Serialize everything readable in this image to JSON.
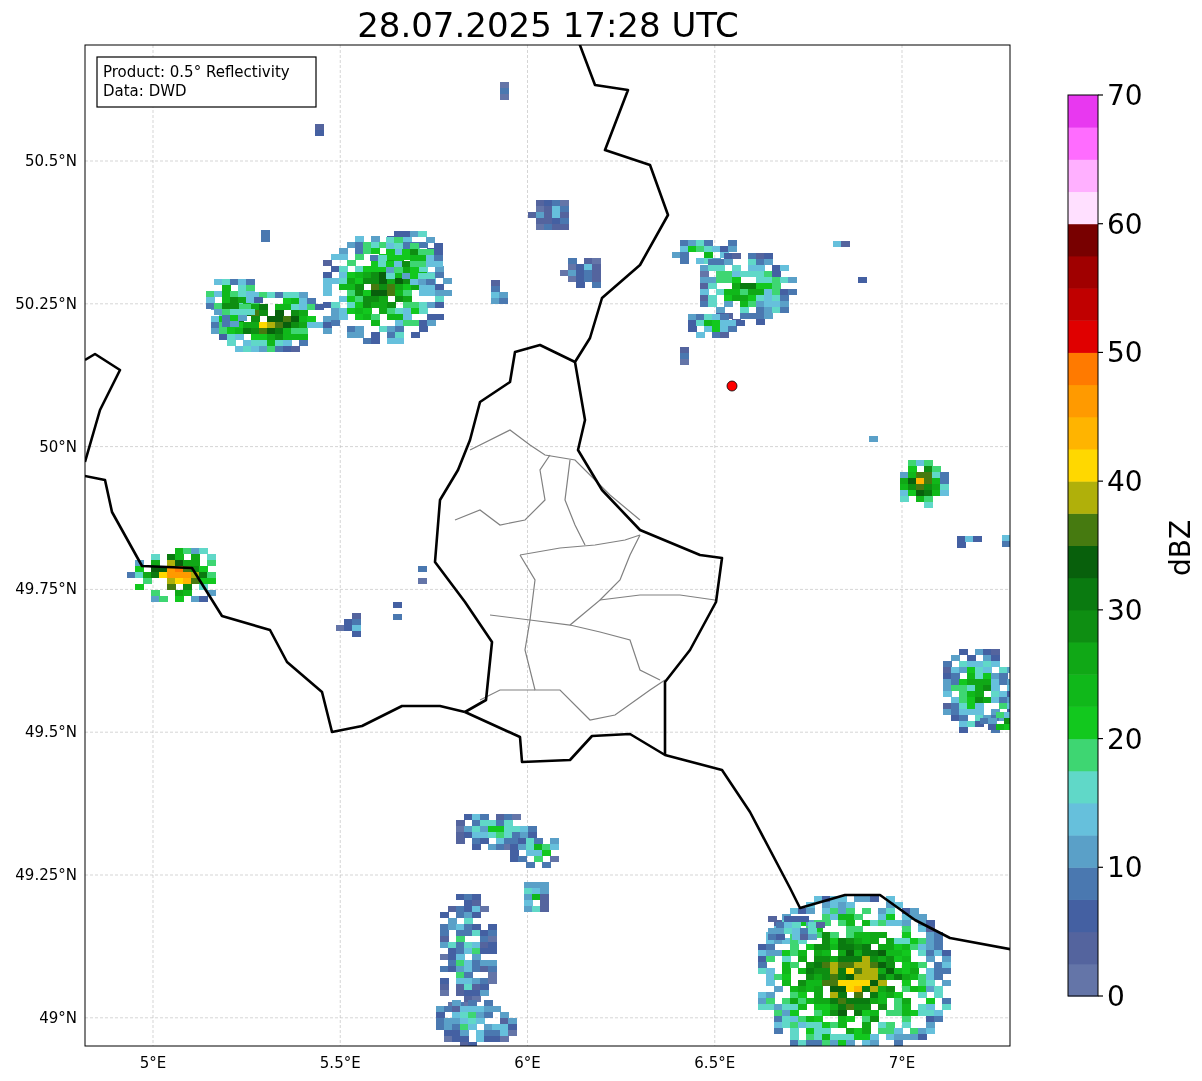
{
  "title": "28.07.2025 17:28 UTC",
  "legend": [
    "Product: 0.5° Reflectivity",
    "Data: DWD"
  ],
  "x_axis": {
    "ticks": [
      "5°E",
      "5.5°E",
      "6°E",
      "6.5°E",
      "7°E"
    ]
  },
  "y_axis": {
    "ticks": [
      "50.5°N",
      "50.25°N",
      "50°N",
      "49.75°N",
      "49.5°N",
      "49.25°N",
      "49°N"
    ]
  },
  "colorbar": {
    "label": "dBZ",
    "ticks": [
      "70",
      "60",
      "50",
      "40",
      "30",
      "20",
      "10",
      "0"
    ],
    "bins": [
      {
        "color": "#6475a8"
      },
      {
        "color": "#54649e"
      },
      {
        "color": "#4460a2"
      },
      {
        "color": "#4a78b0"
      },
      {
        "color": "#5aa0c8"
      },
      {
        "color": "#66c0dc"
      },
      {
        "color": "#60d8c8"
      },
      {
        "color": "#3ed672"
      },
      {
        "color": "#12c81e"
      },
      {
        "color": "#10b81a"
      },
      {
        "color": "#10a816"
      },
      {
        "color": "#0e8e12"
      },
      {
        "color": "#0a7a10"
      },
      {
        "color": "#08600c"
      },
      {
        "color": "#467a10"
      },
      {
        "color": "#b0b00a"
      },
      {
        "color": "#ffd800"
      },
      {
        "color": "#ffb400"
      },
      {
        "color": "#ff9a00"
      },
      {
        "color": "#ff7a00"
      },
      {
        "color": "#e00000"
      },
      {
        "color": "#c00000"
      },
      {
        "color": "#a00000"
      },
      {
        "color": "#780000"
      },
      {
        "color": "#ffe0ff"
      },
      {
        "color": "#ffb0ff"
      },
      {
        "color": "#ff6cff"
      },
      {
        "color": "#e838f0"
      }
    ]
  }
}
